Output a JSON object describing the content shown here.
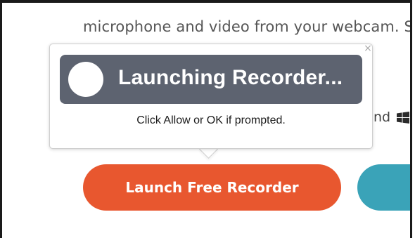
{
  "page": {
    "intro_text": "microphone and video from your webcam. S",
    "trail_text": "nd"
  },
  "popover": {
    "title": "Launching Recorder...",
    "prompt": "Click Allow or OK if prompted.",
    "close_glyph": "×"
  },
  "buttons": {
    "launch_label": "Launch Free Recorder"
  },
  "colors": {
    "launch_button": "#e8572f",
    "second_button": "#3aa3b8",
    "launch_bar": "#5d6370"
  },
  "icons": {
    "windows": "windows-icon",
    "close": "close-icon"
  }
}
